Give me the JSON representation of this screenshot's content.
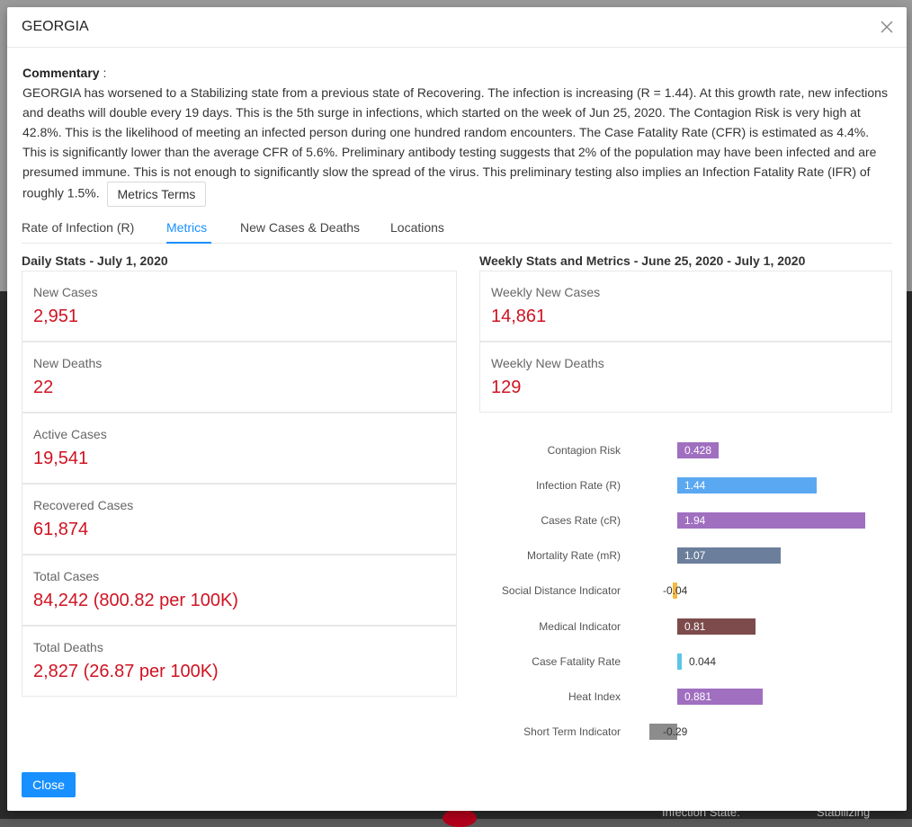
{
  "modal": {
    "title": "GEORGIA",
    "commentary_label": "Commentary",
    "commentary_text": "GEORGIA has worsened to a Stabilizing state from a previous state of Recovering. The infection is increasing (R = 1.44). At this growth rate, new infections and deaths will double every 19 days. This is the 5th surge in infections, which started on the week of Jun 25, 2020. The Contagion Risk is very high at 42.8%. This is the likelihood of meeting an infected person during one hundred random encounters. The Case Fatality Rate (CFR) is estimated as 4.4%. This is significantly lower than the average CFR of 5.6%. Preliminary antibody testing suggests that 2% of the population may have been infected and are presumed immune. This is not enough to significantly slow the spread of the virus. This preliminary testing also implies an Infection Fatality Rate (IFR) of roughly 1.5%.",
    "metrics_terms_label": "Metrics Terms",
    "close_label": "Close"
  },
  "tabs": [
    {
      "label": "Rate of Infection (R)"
    },
    {
      "label": "Metrics"
    },
    {
      "label": "New Cases & Deaths"
    },
    {
      "label": "Locations"
    }
  ],
  "active_tab": "Metrics",
  "daily": {
    "title": "Daily Stats - July 1, 2020",
    "stats": [
      {
        "label": "New Cases",
        "value": "2,951"
      },
      {
        "label": "New Deaths",
        "value": "22"
      },
      {
        "label": "Active Cases",
        "value": "19,541"
      },
      {
        "label": "Recovered Cases",
        "value": "61,874"
      },
      {
        "label": "Total Cases",
        "value": "84,242 (800.82 per 100K)"
      },
      {
        "label": "Total Deaths",
        "value": "2,827 (26.87 per 100K)"
      }
    ]
  },
  "weekly": {
    "title": "Weekly Stats and Metrics - June 25, 2020 - July 1, 2020",
    "stats": [
      {
        "label": "Weekly New Cases",
        "value": "14,861"
      },
      {
        "label": "Weekly New Deaths",
        "value": "129"
      }
    ]
  },
  "chart_data": {
    "type": "bar",
    "orientation": "horizontal",
    "categories": [
      "Contagion Risk",
      "Infection Rate (R)",
      "Cases Rate (cR)",
      "Mortality Rate (mR)",
      "Social Distance Indicator",
      "Medical Indicator",
      "Case Fatality Rate",
      "Heat Index",
      "Short Term Indicator"
    ],
    "values": [
      0.428,
      1.44,
      1.94,
      1.07,
      -0.04,
      0.81,
      0.044,
      0.881,
      -0.29
    ],
    "labels": [
      "0.428",
      "1.44",
      "1.94",
      "1.07",
      "-0.04",
      "0.81",
      "0.044",
      "0.881",
      "-0.29"
    ],
    "colors": [
      "#a06fc0",
      "#5ba8f2",
      "#a06fc0",
      "#6b7f9c",
      "#f5b942",
      "#7d4b4b",
      "#5bc5e8",
      "#a06fc0",
      "#8c8c8c"
    ],
    "xlim": [
      -0.29,
      1.94
    ],
    "grid": false
  },
  "colors": {
    "accent": "#1890ff",
    "value_red": "#cf1322"
  },
  "background": {
    "status_label": "Infection State:",
    "status_value": "Stabilizing"
  }
}
